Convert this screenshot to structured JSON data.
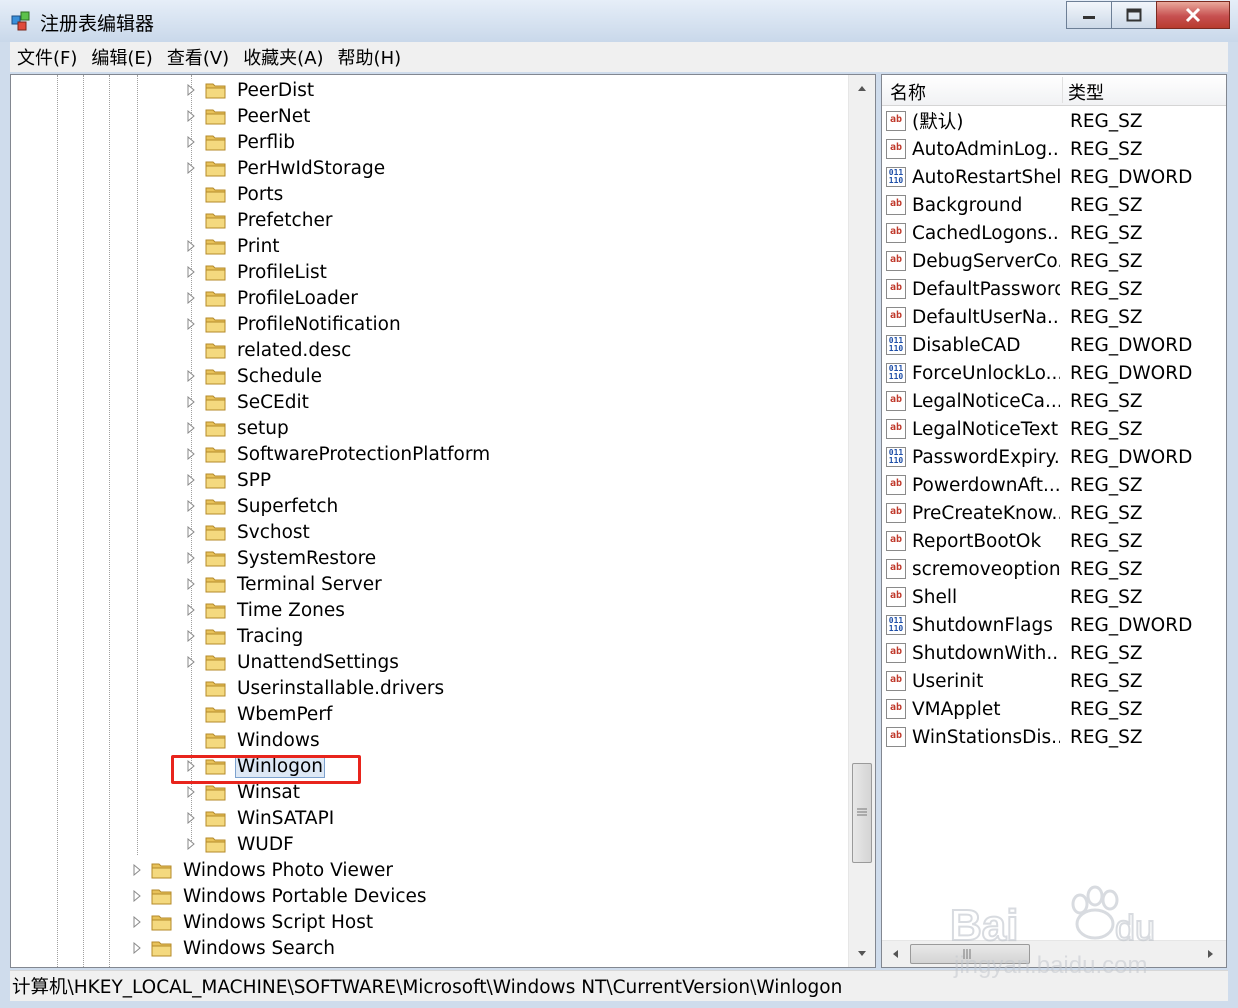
{
  "window": {
    "title": "注册表编辑器"
  },
  "menu": [
    "文件(F)",
    "编辑(E)",
    "查看(V)",
    "收藏夹(A)",
    "帮助(H)"
  ],
  "tree": {
    "children": [
      {
        "label": "PeerDist",
        "expandable": true
      },
      {
        "label": "PeerNet",
        "expandable": true
      },
      {
        "label": "Perflib",
        "expandable": true
      },
      {
        "label": "PerHwIdStorage",
        "expandable": true
      },
      {
        "label": "Ports",
        "expandable": false
      },
      {
        "label": "Prefetcher",
        "expandable": false
      },
      {
        "label": "Print",
        "expandable": true
      },
      {
        "label": "ProfileList",
        "expandable": true
      },
      {
        "label": "ProfileLoader",
        "expandable": true
      },
      {
        "label": "ProfileNotification",
        "expandable": true
      },
      {
        "label": "related.desc",
        "expandable": false
      },
      {
        "label": "Schedule",
        "expandable": true
      },
      {
        "label": "SeCEdit",
        "expandable": true
      },
      {
        "label": "setup",
        "expandable": true
      },
      {
        "label": "SoftwareProtectionPlatform",
        "expandable": true
      },
      {
        "label": "SPP",
        "expandable": true
      },
      {
        "label": "Superfetch",
        "expandable": true
      },
      {
        "label": "Svchost",
        "expandable": true
      },
      {
        "label": "SystemRestore",
        "expandable": true
      },
      {
        "label": "Terminal Server",
        "expandable": true
      },
      {
        "label": "Time Zones",
        "expandable": true
      },
      {
        "label": "Tracing",
        "expandable": true
      },
      {
        "label": "UnattendSettings",
        "expandable": true
      },
      {
        "label": "Userinstallable.drivers",
        "expandable": false
      },
      {
        "label": "WbemPerf",
        "expandable": false
      },
      {
        "label": "Windows",
        "expandable": false
      },
      {
        "label": "Winlogon",
        "expandable": true,
        "selected": true
      },
      {
        "label": "Winsat",
        "expandable": true
      },
      {
        "label": "WinSATAPI",
        "expandable": true
      },
      {
        "label": "WUDF",
        "expandable": true
      }
    ],
    "siblings": [
      {
        "label": "Windows Photo Viewer",
        "expandable": true
      },
      {
        "label": "Windows Portable Devices",
        "expandable": true
      },
      {
        "label": "Windows Script Host",
        "expandable": true
      },
      {
        "label": "Windows Search",
        "expandable": true
      }
    ]
  },
  "values_panel": {
    "col_name": "名称",
    "col_type": "类型",
    "rows": [
      {
        "name": "(默认)",
        "type": "REG_SZ",
        "icon": "string-value-icon"
      },
      {
        "name": "AutoAdminLog...",
        "type": "REG_SZ",
        "icon": "string-value-icon"
      },
      {
        "name": "AutoRestartShell",
        "type": "REG_DWORD",
        "icon": "binary-value-icon"
      },
      {
        "name": "Background",
        "type": "REG_SZ",
        "icon": "string-value-icon"
      },
      {
        "name": "CachedLogons...",
        "type": "REG_SZ",
        "icon": "string-value-icon"
      },
      {
        "name": "DebugServerCo...",
        "type": "REG_SZ",
        "icon": "string-value-icon"
      },
      {
        "name": "DefaultPassword",
        "type": "REG_SZ",
        "icon": "string-value-icon"
      },
      {
        "name": "DefaultUserNa...",
        "type": "REG_SZ",
        "icon": "string-value-icon"
      },
      {
        "name": "DisableCAD",
        "type": "REG_DWORD",
        "icon": "binary-value-icon"
      },
      {
        "name": "ForceUnlockLo...",
        "type": "REG_DWORD",
        "icon": "binary-value-icon"
      },
      {
        "name": "LegalNoticeCa...",
        "type": "REG_SZ",
        "icon": "string-value-icon"
      },
      {
        "name": "LegalNoticeText",
        "type": "REG_SZ",
        "icon": "string-value-icon"
      },
      {
        "name": "PasswordExpiry...",
        "type": "REG_DWORD",
        "icon": "binary-value-icon"
      },
      {
        "name": "PowerdownAft...",
        "type": "REG_SZ",
        "icon": "string-value-icon"
      },
      {
        "name": "PreCreateKnow...",
        "type": "REG_SZ",
        "icon": "string-value-icon"
      },
      {
        "name": "ReportBootOk",
        "type": "REG_SZ",
        "icon": "string-value-icon"
      },
      {
        "name": "scremoveoption",
        "type": "REG_SZ",
        "icon": "string-value-icon"
      },
      {
        "name": "Shell",
        "type": "REG_SZ",
        "icon": "string-value-icon"
      },
      {
        "name": "ShutdownFlags",
        "type": "REG_DWORD",
        "icon": "binary-value-icon"
      },
      {
        "name": "ShutdownWith...",
        "type": "REG_SZ",
        "icon": "string-value-icon"
      },
      {
        "name": "Userinit",
        "type": "REG_SZ",
        "icon": "string-value-icon"
      },
      {
        "name": "VMApplet",
        "type": "REG_SZ",
        "icon": "string-value-icon"
      },
      {
        "name": "WinStationsDis...",
        "type": "REG_SZ",
        "icon": "string-value-icon"
      }
    ]
  },
  "status_path": "计算机\\HKEY_LOCAL_MACHINE\\SOFTWARE\\Microsoft\\Windows NT\\CurrentVersion\\Winlogon",
  "watermark": "Baidu经验 jingyan.baidu.com",
  "icon_glyphs": {
    "string": "ab",
    "dword": "011\n110"
  },
  "colors": {
    "highlight_box": "#e8241c",
    "folder": "#e8c25a",
    "selection": "#dde8f5"
  }
}
